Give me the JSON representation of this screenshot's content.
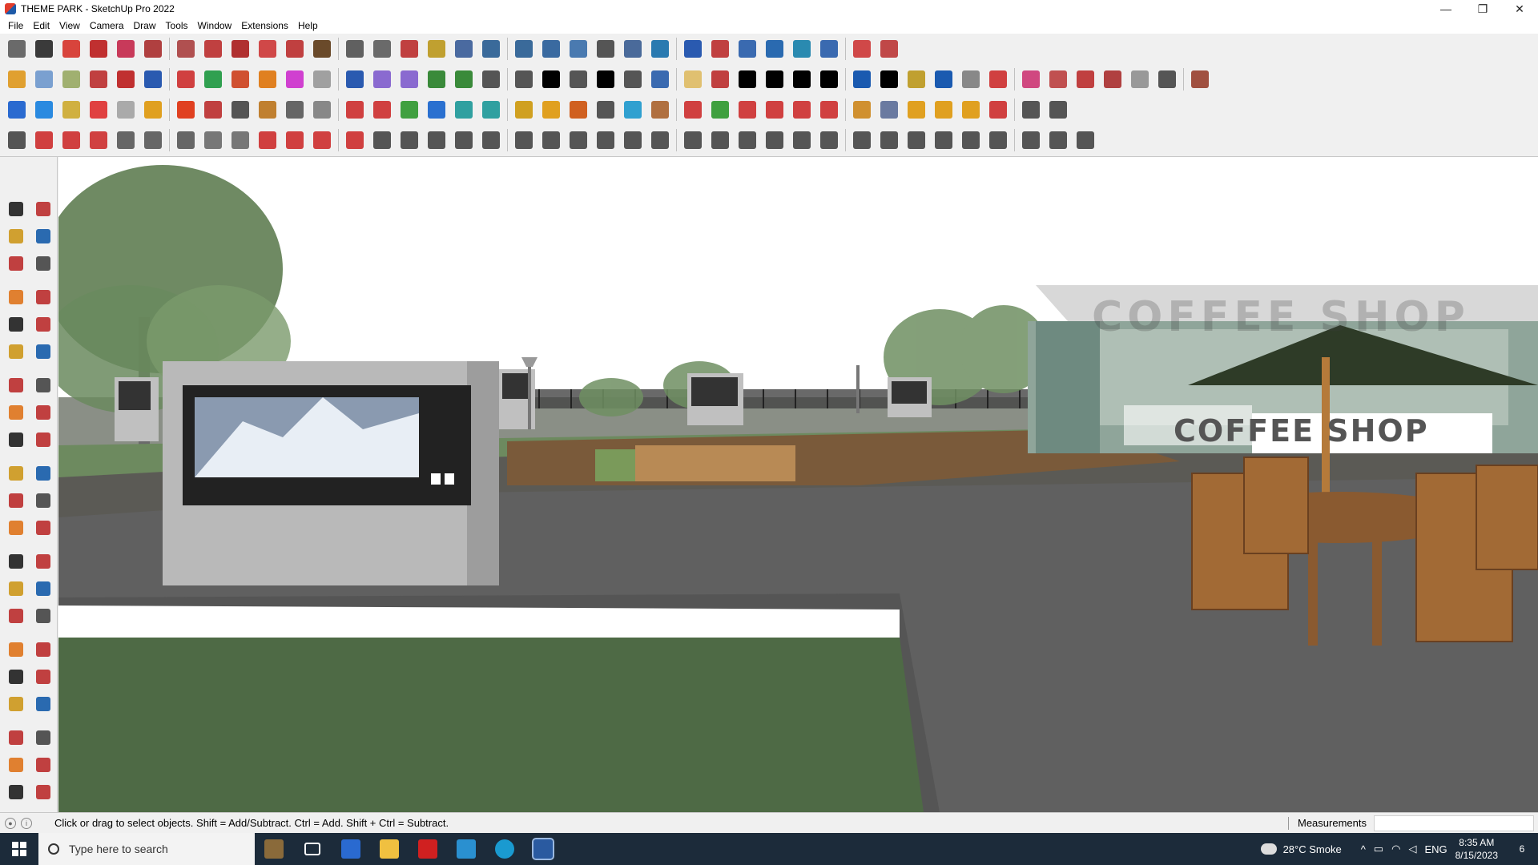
{
  "window": {
    "title": "THEME PARK - SketchUp Pro 2022",
    "controls": [
      "—",
      "❐",
      "✕"
    ]
  },
  "menu": [
    "File",
    "Edit",
    "View",
    "Camera",
    "Draw",
    "Tools",
    "Window",
    "Extensions",
    "Help"
  ],
  "toolbars": {
    "row1_colors": [
      "#6a6a6a",
      "#3a3a3a",
      "#d8443c",
      "#c03030",
      "#c83a5a",
      "#b04040",
      "#b05050",
      "#c04040",
      "#b03030",
      "#d04848",
      "#c04040",
      "#6a4a2a",
      "#606060",
      "#6a6a6a",
      "#c04040",
      "#c0a030",
      "#4a6aa0",
      "#3a6a9a",
      "#3a6a9a",
      "#3a6aa0",
      "#4a7ab0",
      "#555",
      "#4a6a9a",
      "#2a7ab0",
      "#2a5ab0",
      "#c04040",
      "#3a6ab0",
      "#2a6ab0",
      "#2a8ab0",
      "#3a6ab0",
      "#d04848",
      "#c04848"
    ],
    "row2_colors": [
      "#e0a030",
      "#7aa0d0",
      "#a0b070",
      "#c04040",
      "#c03030",
      "#2a5ab0",
      "#d04040",
      "#30a050",
      "#d05030",
      "#e08020",
      "#d040d0",
      "#a0a0a0",
      "#2a5ab0",
      "#8a6ad0",
      "#8a6ad0",
      "#3a8a3a",
      "#3a8a3a",
      "#555",
      "#555",
      "#000",
      "#555",
      "#000",
      "#555",
      "#3a6ab0",
      "#e0c070",
      "#c04040",
      "#000",
      "#000",
      "#000",
      "#000",
      "#1a5ab0",
      "#000",
      "#c0a030",
      "#1a5ab0",
      "#888",
      "#d04040",
      "#d04880",
      "#c05050",
      "#c04040",
      "#b04040",
      "#999",
      "#555",
      "#a05040"
    ],
    "row3_colors": [
      "#2a6ad0",
      "#2a8ae0",
      "#d0b040",
      "#e04040",
      "#aaa",
      "#e0a020",
      "#e04020",
      "#c04040",
      "#555",
      "#c08030",
      "#666",
      "#888",
      "#d04040",
      "#d04040",
      "#40a040",
      "#2a70d0",
      "#30a0a0",
      "#30a0a0",
      "#d0a020",
      "#e0a020",
      "#d06020",
      "#555",
      "#30a0d0",
      "#b07040",
      "#d04040",
      "#40a040",
      "#d04040",
      "#d04040",
      "#d04040",
      "#d04040",
      "#d09030",
      "#6a7aa0",
      "#e0a020",
      "#e0a020",
      "#e0a020",
      "#d04040",
      "#555",
      "#555"
    ],
    "row4_colors": [
      "#555",
      "#d04040",
      "#d04040",
      "#d04040",
      "#666",
      "#666",
      "#666",
      "#777",
      "#777",
      "#d04040",
      "#d04040",
      "#d04040",
      "#d04040",
      "#555",
      "#555",
      "#555",
      "#555",
      "#555",
      "#555",
      "#555",
      "#555",
      "#555",
      "#555",
      "#555",
      "#555",
      "#555",
      "#555",
      "#555",
      "#555",
      "#555",
      "#555",
      "#555",
      "#555",
      "#555",
      "#555",
      "#555",
      "#555",
      "#555",
      "#555"
    ]
  },
  "left_tools": [
    "select-icon",
    "orbit-icon",
    "paint-bucket-icon",
    "eraser-icon",
    "component-icon",
    "tape-measure-icon",
    "line-icon",
    "freehand-icon",
    "rectangle-icon",
    "rotated-rectangle-icon",
    "circle-icon",
    "polygon-icon",
    "arc-icon",
    "pie-icon",
    "two-point-arc-icon",
    "three-point-arc-icon",
    "move-icon",
    "push-pull-icon",
    "rotate-icon",
    "follow-me-icon",
    "scale-icon",
    "offset-icon",
    "tape-icon",
    "dimension-icon",
    "protractor-icon",
    "text-icon",
    "axes-icon",
    "3d-text-icon",
    "orbit2-icon",
    "pan-icon",
    "zoom-icon",
    "zoom-window-icon",
    "zoom-extents-icon",
    "previous-icon",
    "position-camera-icon",
    "look-around-icon",
    "walk-icon",
    "section-plane-icon",
    "section-display-icon",
    "section-fill-icon",
    "layers-icon",
    "outliner-icon"
  ],
  "scene": {
    "coffee_sign": "COFFEE SHOP",
    "coffee_sign_ghost": "COFFEE SHOP"
  },
  "status": {
    "message": "Click or drag to select objects. Shift = Add/Subtract. Ctrl = Add. Shift + Ctrl = Subtract.",
    "measurements_label": "Measurements",
    "measurements_value": ""
  },
  "taskbar": {
    "search_placeholder": "Type here to search",
    "weather": "28°C  Smoke",
    "language": "ENG",
    "time": "8:35 AM",
    "date": "8/15/2023",
    "notifications": "6"
  }
}
